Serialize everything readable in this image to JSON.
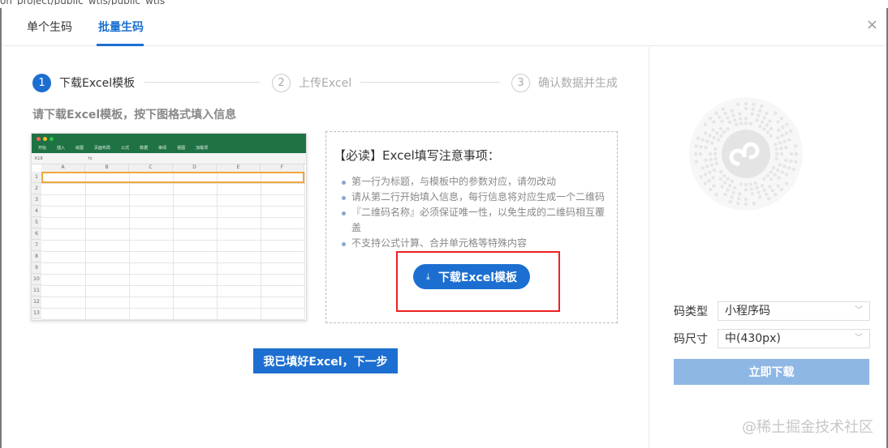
{
  "background": {
    "path_text": "on_project/public_wtis/public_wtis"
  },
  "tabs": [
    {
      "label": "单个生码"
    },
    {
      "label": "批量生码"
    }
  ],
  "close_label": "×",
  "steps": [
    {
      "num": "1",
      "label": "下载Excel模板"
    },
    {
      "num": "2",
      "label": "上传Excel"
    },
    {
      "num": "3",
      "label": "确认数据并生成"
    }
  ],
  "hint": "请下载Excel模板，按下图格式填入信息",
  "sheet": {
    "menu": [
      "开始",
      "插入",
      "绘图",
      "页面布局",
      "公式",
      "数据",
      "审阅",
      "视图",
      "加载项"
    ],
    "cell_ref": "K18",
    "fx": "fx",
    "columns": [
      "A",
      "B",
      "C",
      "D",
      "E",
      "F"
    ],
    "rows": [
      "1",
      "2",
      "3",
      "4",
      "5",
      "6",
      "7",
      "8",
      "9",
      "10",
      "11",
      "12",
      "13"
    ]
  },
  "notes": {
    "title": "【必读】Excel填写注意事项：",
    "items": [
      "第一行为标题，与模板中的参数对应，请勿改动",
      "请从第二行开始填入信息，每行信息将对应生成一个二维码",
      "『二维码名称』必须保证唯一性，以免生成的二维码相互覆盖",
      "不支持公式计算、合并单元格等特殊内容"
    ],
    "download_label": "下载Excel模板",
    "download_icon": "download-icon"
  },
  "next_label": "我已填好Excel，下一步",
  "right": {
    "type_label": "码类型",
    "type_value": "小程序码",
    "size_label": "码尺寸",
    "size_value": "中(430px)",
    "get_label": "立即下载"
  },
  "watermark": "@稀土掘金技术社区",
  "colors": {
    "accent": "#1c6fd0",
    "disabled": "#8fb7e4",
    "highlight": "#e22222",
    "excel_green": "#1f7244"
  }
}
